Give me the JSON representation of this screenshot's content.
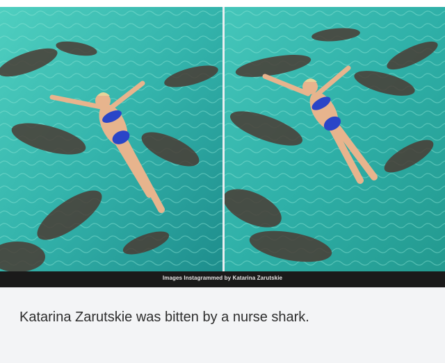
{
  "photo": {
    "credit": "Images Instagrammed by Katarina Zarutskie"
  },
  "caption": {
    "text": "Katarina Zarutskie was bitten by a nurse shark."
  },
  "colors": {
    "water_light": "#3fc0b4",
    "water_deep": "#1f8f8e",
    "shark": "#4a3c34",
    "bikini": "#2a45c8",
    "skin": "#e7b48d",
    "caption_background": "#f3f4f6",
    "caption_text": "#2d2d2d"
  }
}
